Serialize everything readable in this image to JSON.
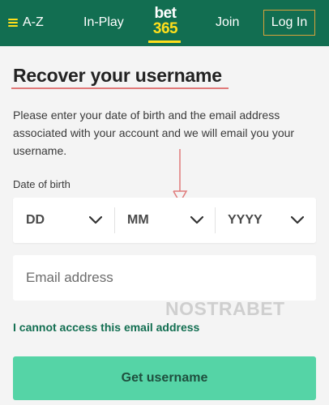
{
  "nav": {
    "az_label": "A-Z",
    "inplay_label": "In-Play",
    "logo_line1": "bet",
    "logo_line2": "365",
    "join_label": "Join",
    "login_label": "Log In"
  },
  "page": {
    "title": "Recover your username",
    "intro": "Please enter your date of birth and the email address associated with your account and we will email you your username.",
    "dob_label": "Date of birth",
    "dob": {
      "day_placeholder": "DD",
      "month_placeholder": "MM",
      "year_placeholder": "YYYY"
    },
    "email_placeholder": "Email address",
    "cannot_access_link": "I cannot access this email address",
    "submit_label": "Get username"
  },
  "watermark": "NOSTRABET",
  "colors": {
    "header_green": "#126e51",
    "accent_yellow": "#ffdf1b",
    "button_green": "#55d4a6",
    "link_green": "#126e51",
    "annotation_red": "#e07a7a"
  }
}
